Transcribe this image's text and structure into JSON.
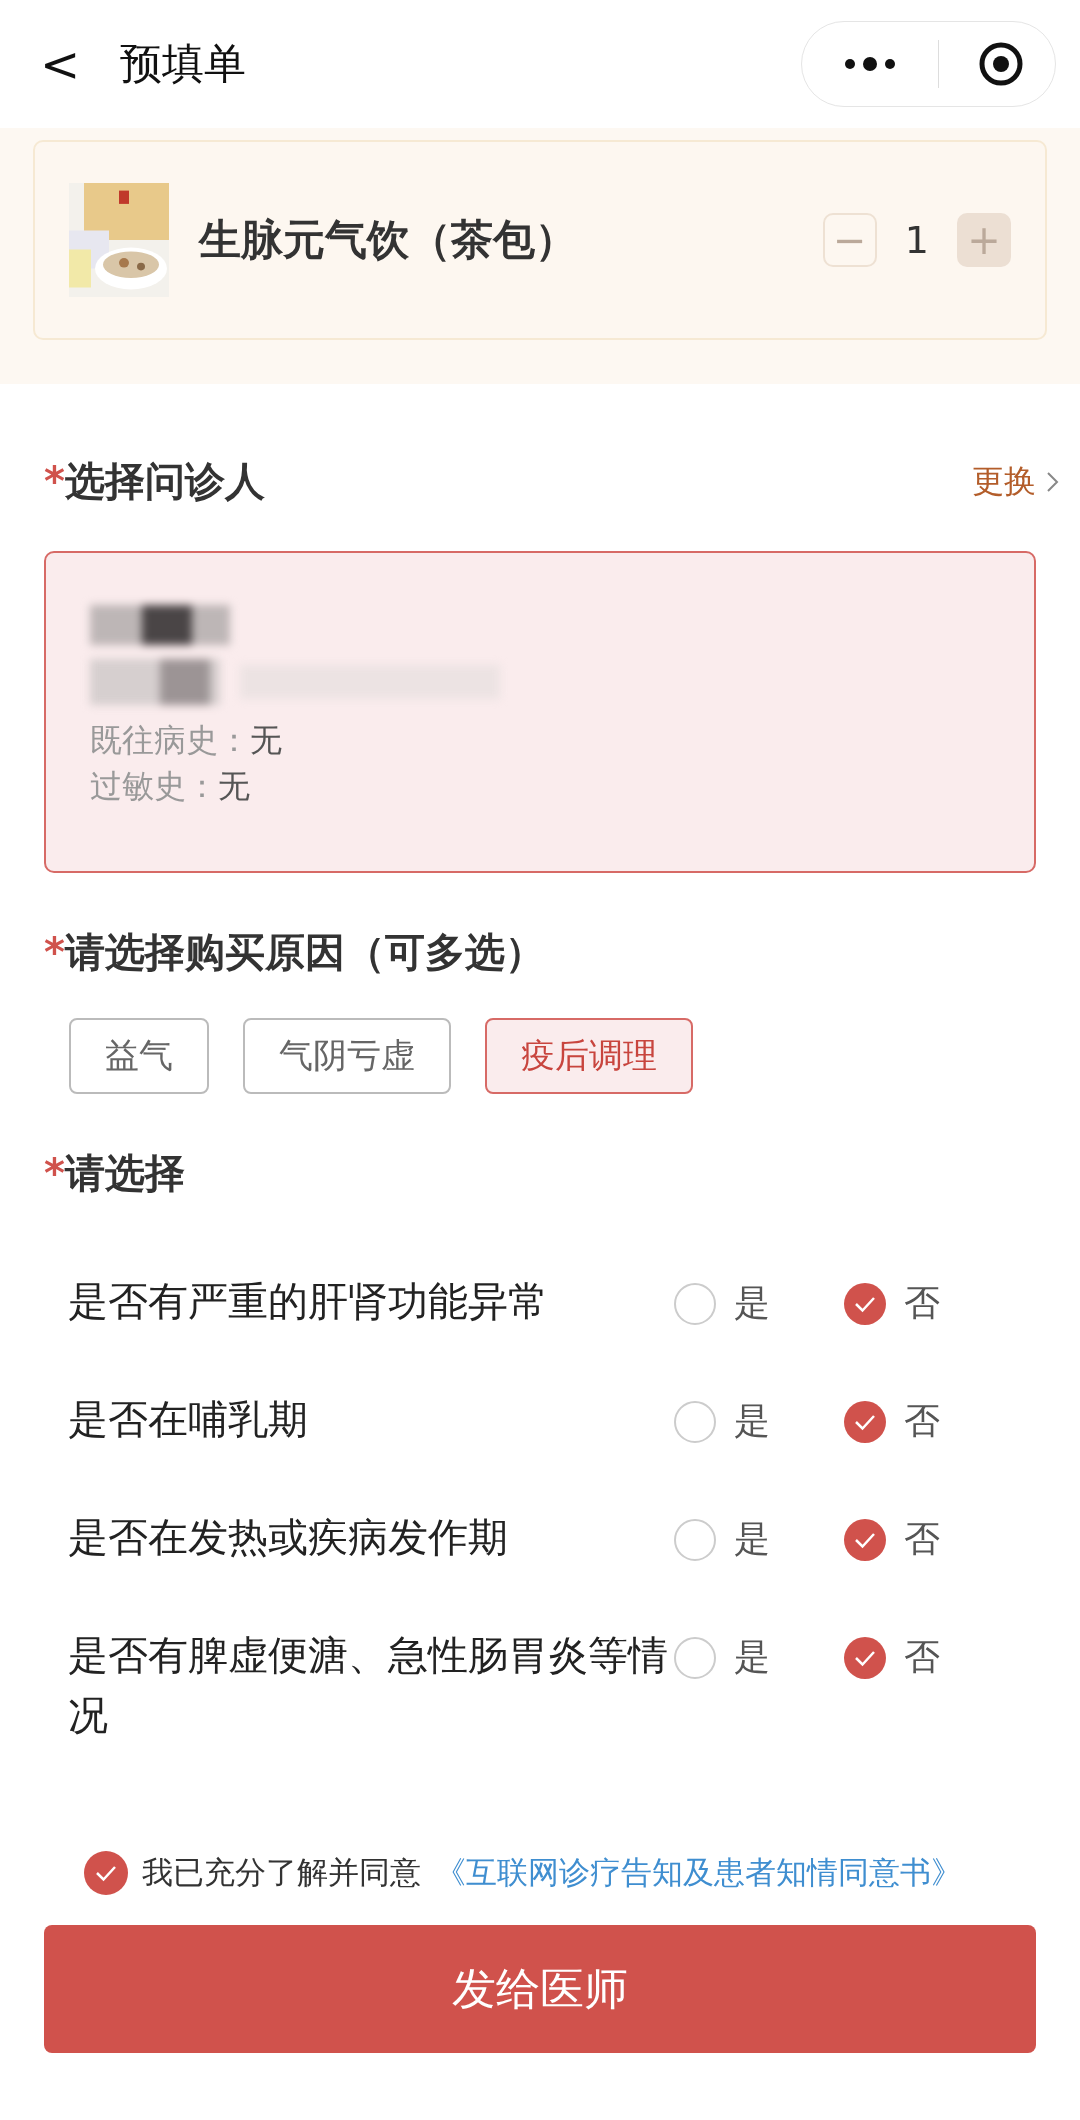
{
  "nav": {
    "back": "<",
    "title": "预填单"
  },
  "product": {
    "kind": "picture",
    "name": "生脉元气饮（茶包）",
    "minus": "−",
    "quantity": "1",
    "plus": "+"
  },
  "patient_section": {
    "required": "*",
    "title": "选择问诊人",
    "action": "更换"
  },
  "patient": {
    "history_label": "既往病史：",
    "history": "无",
    "allergy_label": "过敏史：",
    "allergy": "无"
  },
  "reason_section": {
    "required": "*",
    "title": "请选择购买原因（可多选）"
  },
  "reasons": [
    {
      "label": "益气",
      "selected": false
    },
    {
      "label": "气阴亏虚",
      "selected": false
    },
    {
      "label": "疫后调理",
      "selected": true
    }
  ],
  "questions_section": {
    "required": "*",
    "title": "请选择"
  },
  "questions": [
    {
      "text": "是否有严重的肝肾功能异常",
      "options": [
        {
          "label": "是",
          "selected": false
        },
        {
          "label": "否",
          "selected": true
        }
      ]
    },
    {
      "text": "是否在哺乳期",
      "options": [
        {
          "label": "是",
          "selected": false
        },
        {
          "label": "否",
          "selected": true
        }
      ]
    },
    {
      "text": "是否在发热或疾病发作期",
      "options": [
        {
          "label": "是",
          "selected": false
        },
        {
          "label": "否",
          "selected": true
        }
      ]
    },
    {
      "text": "是否有脾虚便溏、急性肠胃炎等情况",
      "options": [
        {
          "label": "是",
          "selected": false
        },
        {
          "label": "否",
          "selected": true
        }
      ]
    }
  ],
  "agreement": {
    "checked": true,
    "text": "我已充分了解并同意",
    "link": "《互联网诊疗告知及患者知情同意书》"
  },
  "submit": "发给医师"
}
